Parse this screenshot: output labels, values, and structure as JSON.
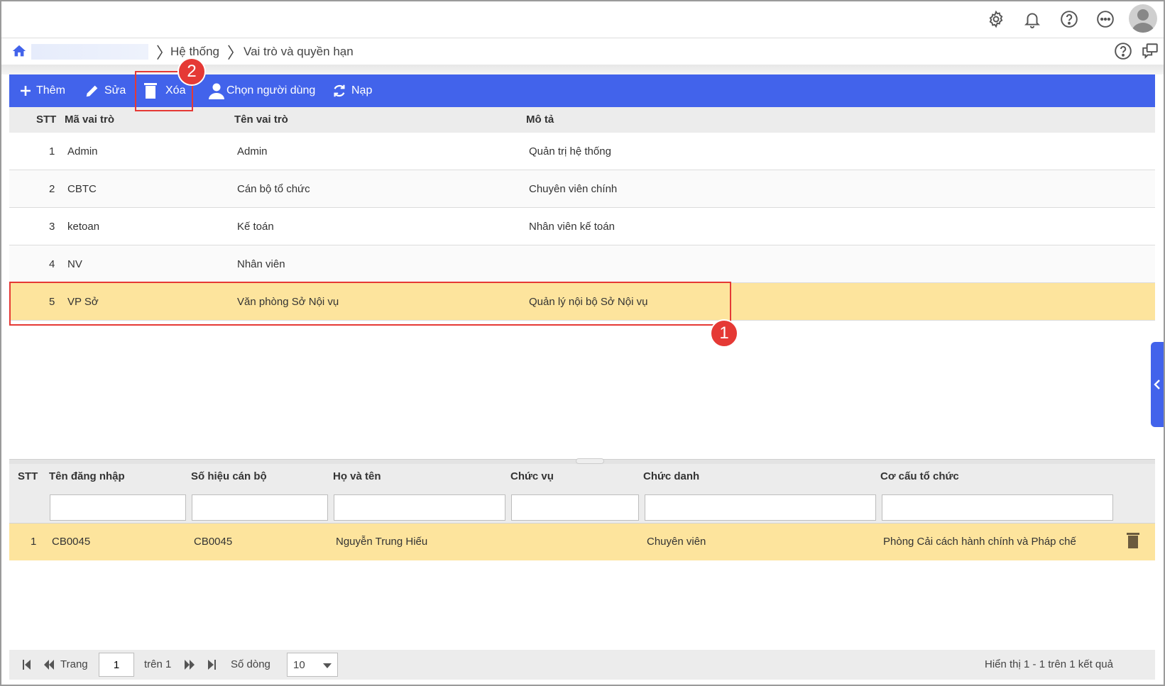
{
  "breadcrumb": {
    "items": [
      "Hệ thống",
      "Vai trò và quyền hạn"
    ]
  },
  "toolbar": {
    "add_label": "Thêm",
    "edit_label": "Sửa",
    "delete_label": "Xóa",
    "select_users_label": "Chọn người dùng",
    "reload_label": "Nạp"
  },
  "roles_grid": {
    "columns": [
      "STT",
      "Mã vai trò",
      "Tên vai trò",
      "Mô tả"
    ],
    "rows": [
      {
        "stt": "1",
        "code": "Admin",
        "name": "Admin",
        "desc": "Quản trị hệ thống"
      },
      {
        "stt": "2",
        "code": "CBTC",
        "name": "Cán bộ tổ chức",
        "desc": "Chuyên viên chính"
      },
      {
        "stt": "3",
        "code": "ketoan",
        "name": "Kế toán",
        "desc": "Nhân viên kế toán"
      },
      {
        "stt": "4",
        "code": "NV",
        "name": "Nhân viên",
        "desc": ""
      },
      {
        "stt": "5",
        "code": "VP Sở",
        "name": "Văn phòng Sở Nội vụ",
        "desc": "Quản lý nội bộ Sở Nội vụ"
      }
    ],
    "selected_index": 4
  },
  "users_grid": {
    "columns": [
      "STT",
      "Tên đăng nhập",
      "Số hiệu cán bộ",
      "Họ và tên",
      "Chức vụ",
      "Chức danh",
      "Cơ cấu tổ chức"
    ],
    "rows": [
      {
        "stt": "1",
        "login": "CB0045",
        "staff_no": "CB0045",
        "full_name": "Nguyễn Trung Hiếu",
        "position": "",
        "title": "Chuyên viên",
        "org": "Phòng Cải cách hành chính và Pháp chế"
      }
    ]
  },
  "pager": {
    "page_label": "Trang",
    "page_value": "1",
    "of_label": "trên 1",
    "rows_label": "Số dòng",
    "rows_value": "10",
    "summary": "Hiển thị 1 - 1 trên 1 kết quả"
  },
  "annotations": {
    "badge_1": "1",
    "badge_2": "2"
  },
  "colors": {
    "toolbar_bg": "#4263eb",
    "selected_row": "#fde49d",
    "callout": "#e53935"
  }
}
